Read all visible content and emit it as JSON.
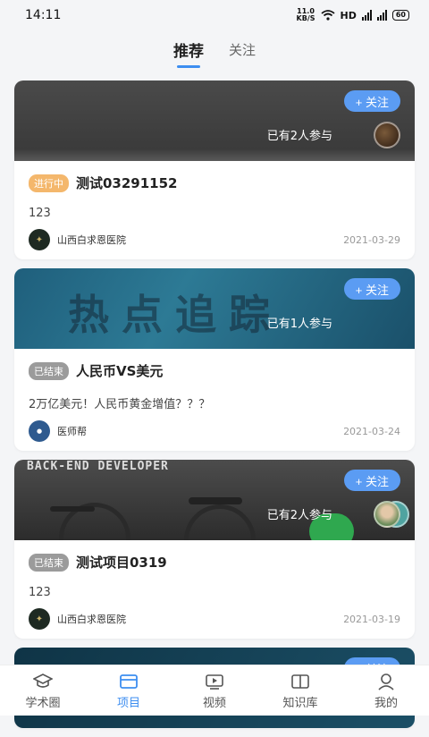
{
  "status_bar": {
    "time": "14:11",
    "net_speed_value": "11.0",
    "net_speed_unit": "KB/S",
    "hd": "HD",
    "battery": "60"
  },
  "tabs": [
    {
      "label": "推荐",
      "active": true
    },
    {
      "label": "关注",
      "active": false
    }
  ],
  "cards": [
    {
      "follow_label": "+ 关注",
      "participants": "已有2人参与",
      "status": "进行中",
      "title": "测试03291152",
      "description": "123",
      "org_name": "山西白求恩医院",
      "date": "2021-03-29"
    },
    {
      "follow_label": "+ 关注",
      "participants": "已有1人参与",
      "banner_text": "热点追踪",
      "status": "已结束",
      "title": "人民币VS美元",
      "description": "2万亿美元！人民币黄金增值？？？",
      "org_name": "医师帮",
      "date": "2021-03-24"
    },
    {
      "follow_label": "+ 关注",
      "participants": "已有2人参与",
      "banner_text": "BACK-END DEVELOPER",
      "status": "已结束",
      "title": "测试项目0319",
      "description": "123",
      "org_name": "山西白求恩医院",
      "date": "2021-03-19"
    },
    {
      "follow_label": "+ 关注"
    }
  ],
  "bottom_nav": [
    {
      "label": "学术圈",
      "icon": "mortarboard-icon"
    },
    {
      "label": "项目",
      "icon": "folder-icon",
      "active": true
    },
    {
      "label": "视频",
      "icon": "video-icon"
    },
    {
      "label": "知识库",
      "icon": "book-icon"
    },
    {
      "label": "我的",
      "icon": "user-icon"
    }
  ],
  "colors": {
    "accent": "#3d8ef0",
    "follow_button": "#5b9cf3",
    "ongoing_badge": "#f4b76c",
    "ended_badge": "#9b9b9b"
  }
}
